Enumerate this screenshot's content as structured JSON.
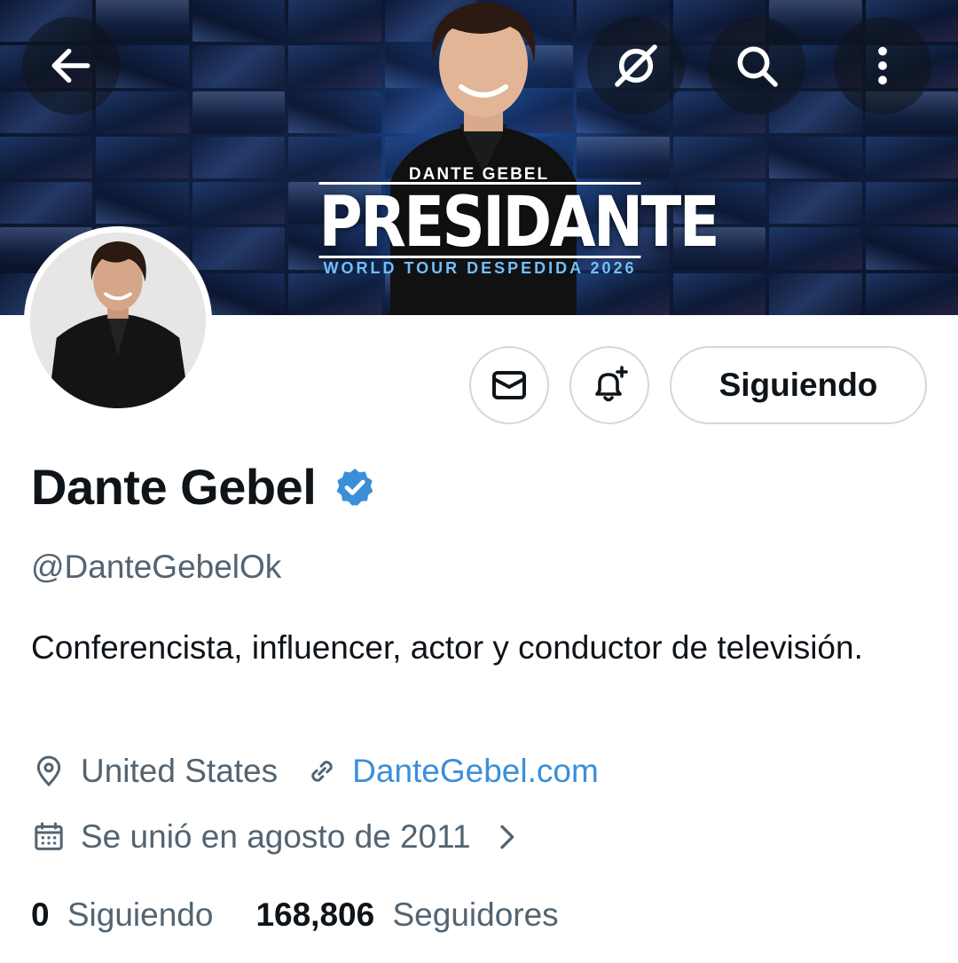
{
  "banner": {
    "poster_subtitle": "DANTE GEBEL",
    "poster_title": "PRESIDANTE",
    "poster_tour": "WORLD TOUR DESPEDIDA 2026",
    "icons": [
      "arrow-left-icon",
      "grok-icon",
      "search-icon",
      "more-vertical-icon"
    ]
  },
  "actions": {
    "message_icon": "envelope-icon",
    "notify_icon": "bell-plus-icon",
    "follow_label": "Siguiendo"
  },
  "profile": {
    "name": "Dante Gebel",
    "verified": true,
    "handle": "@DanteGebelOk",
    "bio": "Conferencista, influencer, actor y conductor de televisión.",
    "location": "United States",
    "website": "DanteGebel.com",
    "joined": "Se unió en agosto de 2011"
  },
  "stats": {
    "following_count": "0",
    "following_label": "Siguiendo",
    "followers_count": "168,806",
    "followers_label": "Seguidores"
  },
  "colors": {
    "accent": "#1d9bf0",
    "text_primary": "#0f1419",
    "text_secondary": "#536471",
    "border": "#cfd9de"
  }
}
